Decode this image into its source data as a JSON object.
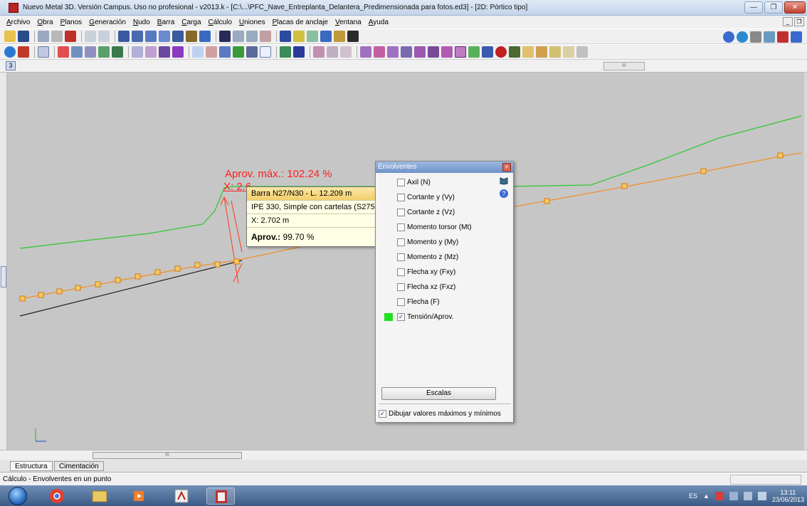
{
  "window": {
    "title": "Nuevo Metal 3D. Versión Campus. Uso no profesional - v2013.k - [C:\\...\\PFC_Nave_Entreplanta_Delantera_Predimensionada para fotos.ed3] - [2D: Pórtico tipo]"
  },
  "menu": [
    "Archivo",
    "Obra",
    "Planos",
    "Generación",
    "Nudo",
    "Barra",
    "Carga",
    "Cálculo",
    "Uniones",
    "Placas de anclaje",
    "Ventana",
    "Ayuda"
  ],
  "scrollbars": {
    "thumb_label": "III"
  },
  "canvas": {
    "aprov_max": "Aprov. máx.: 102.24 %",
    "aprov_x": "X: 2.630 m",
    "colors": {
      "envelope_line": "#2ec52e",
      "beam_line": "#f0902a",
      "node_fill": "#f7c860",
      "marker": "#ff3a1a"
    }
  },
  "tooltip": {
    "header": "Barra N27/N30 - L. 12.209 m",
    "section": "IPE 330, Simple con cartelas (S275)",
    "x": "X: 2.702 m",
    "aprov_label": "Aprov.:",
    "aprov_value": "99.70 %"
  },
  "envolventes": {
    "title": "Envolventes",
    "items": [
      {
        "label": "Axil (N)",
        "checked": false
      },
      {
        "label": "Cortante y (Vy)",
        "checked": false
      },
      {
        "label": "Cortante z (Vz)",
        "checked": false
      },
      {
        "label": "Momento torsor (Mt)",
        "checked": false
      },
      {
        "label": "Momento y (My)",
        "checked": false
      },
      {
        "label": "Momento z (Mz)",
        "checked": false
      },
      {
        "label": "Flecha xy (Fxy)",
        "checked": false
      },
      {
        "label": "Flecha xz (Fxz)",
        "checked": false
      },
      {
        "label": "Flecha (F)",
        "checked": false
      },
      {
        "label": "Tensión/Aprov.",
        "checked": true
      }
    ],
    "escalas_button": "Escalas",
    "draw_minmax": {
      "label": "Dibujar valores máximos y mínimos",
      "checked": true
    }
  },
  "tabs": [
    "Estructura",
    "Cimentación"
  ],
  "status": {
    "text": "Cálculo - Envolventes en un punto"
  },
  "taskbar": {
    "lang": "ES",
    "time": "13:11",
    "date": "23/06/2013"
  }
}
